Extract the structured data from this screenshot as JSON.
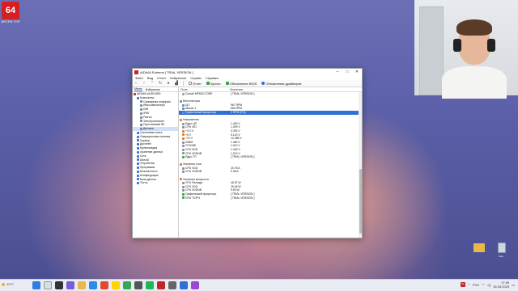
{
  "overlay": {
    "logo": "64",
    "logo_sub": "ARCEN\nTOP"
  },
  "window": {
    "title": "AIDA64 Extreme  [ TRIAL VERSION ]",
    "menu": [
      "Файл",
      "Вид",
      "Отчет",
      "Избранное",
      "Сервис",
      "Справка"
    ],
    "toolbar": {
      "report": "Отчет",
      "buy": "Купить",
      "bios": "Обновление BIOS",
      "drivers": "Обновления драйверов"
    },
    "tree_tabs": [
      "Меню",
      "Избранное"
    ],
    "tree_items": [
      {
        "label": "AIDA64 v6.85.6300",
        "indent": 0
      },
      {
        "label": "Компьютер",
        "indent": 1
      },
      {
        "label": "Суммарная информа",
        "indent": 2
      },
      {
        "label": "Имя компьютера",
        "indent": 2
      },
      {
        "label": "DMI",
        "indent": 2
      },
      {
        "label": "IPMI",
        "indent": 2
      },
      {
        "label": "Разгон",
        "indent": 2
      },
      {
        "label": "Электропитание",
        "indent": 2
      },
      {
        "label": "Портативный ПК",
        "indent": 2
      },
      {
        "label": "Датчики",
        "indent": 2,
        "selected": true
      },
      {
        "label": "Системная плата",
        "indent": 1
      },
      {
        "label": "Операционная система",
        "indent": 1
      },
      {
        "label": "Сервер",
        "indent": 1
      },
      {
        "label": "Дисплей",
        "indent": 1
      },
      {
        "label": "Мультимедиа",
        "indent": 1
      },
      {
        "label": "Хранение данных",
        "indent": 1
      },
      {
        "label": "Сеть",
        "indent": 1
      },
      {
        "label": "DirectX",
        "indent": 1
      },
      {
        "label": "Устройства",
        "indent": 1
      },
      {
        "label": "Программы",
        "indent": 1
      },
      {
        "label": "Безопасность",
        "indent": 1
      },
      {
        "label": "Конфигурация",
        "indent": 1
      },
      {
        "label": "База данных",
        "indent": 1
      },
      {
        "label": "Тесты",
        "indent": 1
      }
    ],
    "columns": [
      "Поле",
      "Значение"
    ],
    "rows": [
      {
        "type": "item",
        "field": "Corsair MP600 CORE",
        "value": "[ TRIAL VERSION ]",
        "color": "#9aa0a6"
      },
      {
        "type": "blank"
      },
      {
        "type": "section",
        "field": "Вентиляторы",
        "color": "#6c8ab8"
      },
      {
        "type": "item",
        "field": "ЦП",
        "value": "967 RPM",
        "color": "#6c8ab8"
      },
      {
        "type": "item",
        "field": "Шасси 1",
        "value": "660 RPM",
        "color": "#6c8ab8"
      },
      {
        "type": "item",
        "field": "Графический процессор",
        "value": "0 RPM  (0%)",
        "color": "#6c8ab8",
        "selected": true
      },
      {
        "type": "blank"
      },
      {
        "type": "section",
        "field": "Напряжения",
        "color": "#e07b2a"
      },
      {
        "type": "item",
        "field": "Ядро ЦП",
        "value": "1.400 V",
        "color": "#8a8f99"
      },
      {
        "type": "item",
        "field": "CPU VID",
        "value": "1.009 V",
        "color": "#8a8f99"
      },
      {
        "type": "item",
        "field": "+3.3 V",
        "value": "3.392 V",
        "color": "#e07b2a"
      },
      {
        "type": "item",
        "field": "+5 V",
        "value": "5.120 V",
        "color": "#e07b2a"
      },
      {
        "type": "item",
        "field": "+12 V",
        "value": "12.288 V",
        "color": "#e07b2a"
      },
      {
        "type": "item",
        "field": "DIMM",
        "value": "1.360 V",
        "color": "#8a8f99"
      },
      {
        "type": "item",
        "field": "CPU/NB",
        "value": "1.012 V",
        "color": "#8a8f99"
      },
      {
        "type": "item",
        "field": "CPU VDD",
        "value": "1.418 V",
        "color": "#8a8f99"
      },
      {
        "type": "item",
        "field": "CPU VDDNB",
        "value": "1.012 V",
        "color": "#8a8f99"
      },
      {
        "type": "item",
        "field": "Ядро ГП",
        "value": "[ TRIAL VERSION ]",
        "color": "#3aa04a"
      },
      {
        "type": "blank"
      },
      {
        "type": "section",
        "field": "Значения тока",
        "color": "#e07b2a"
      },
      {
        "type": "item",
        "field": "CPU VDD",
        "value": "20.78 A",
        "color": "#8a8f99"
      },
      {
        "type": "item",
        "field": "CPU VDDNB",
        "value": "9.38 A",
        "color": "#8a8f99"
      },
      {
        "type": "blank"
      },
      {
        "type": "section",
        "field": "Значения мощности",
        "color": "#e07b2a"
      },
      {
        "type": "item",
        "field": "CPU Package",
        "value": "46.57 W",
        "color": "#8a8f99"
      },
      {
        "type": "item",
        "field": "CPU VDD",
        "value": "29.46 W",
        "color": "#8a8f99"
      },
      {
        "type": "item",
        "field": "CPU VDDNB",
        "value": "9.50 W",
        "color": "#8a8f99"
      },
      {
        "type": "item",
        "field": "Графический процессор",
        "value": "[ TRIAL VERSION ]",
        "color": "#3aa04a"
      },
      {
        "type": "item",
        "field": "GPU TDP%",
        "value": "[ TRIAL VERSION ]",
        "color": "#3aa04a"
      }
    ]
  },
  "desktop": {
    "icon1": "",
    "icon2": "Кор..."
  },
  "taskbar": {
    "weather": "12°C",
    "lang": "РУС",
    "time": "17:39",
    "date": "15.03.2023",
    "badge": "64"
  },
  "colors": {
    "accent": "#2f6fd6",
    "aida_red": "#c0262a"
  }
}
